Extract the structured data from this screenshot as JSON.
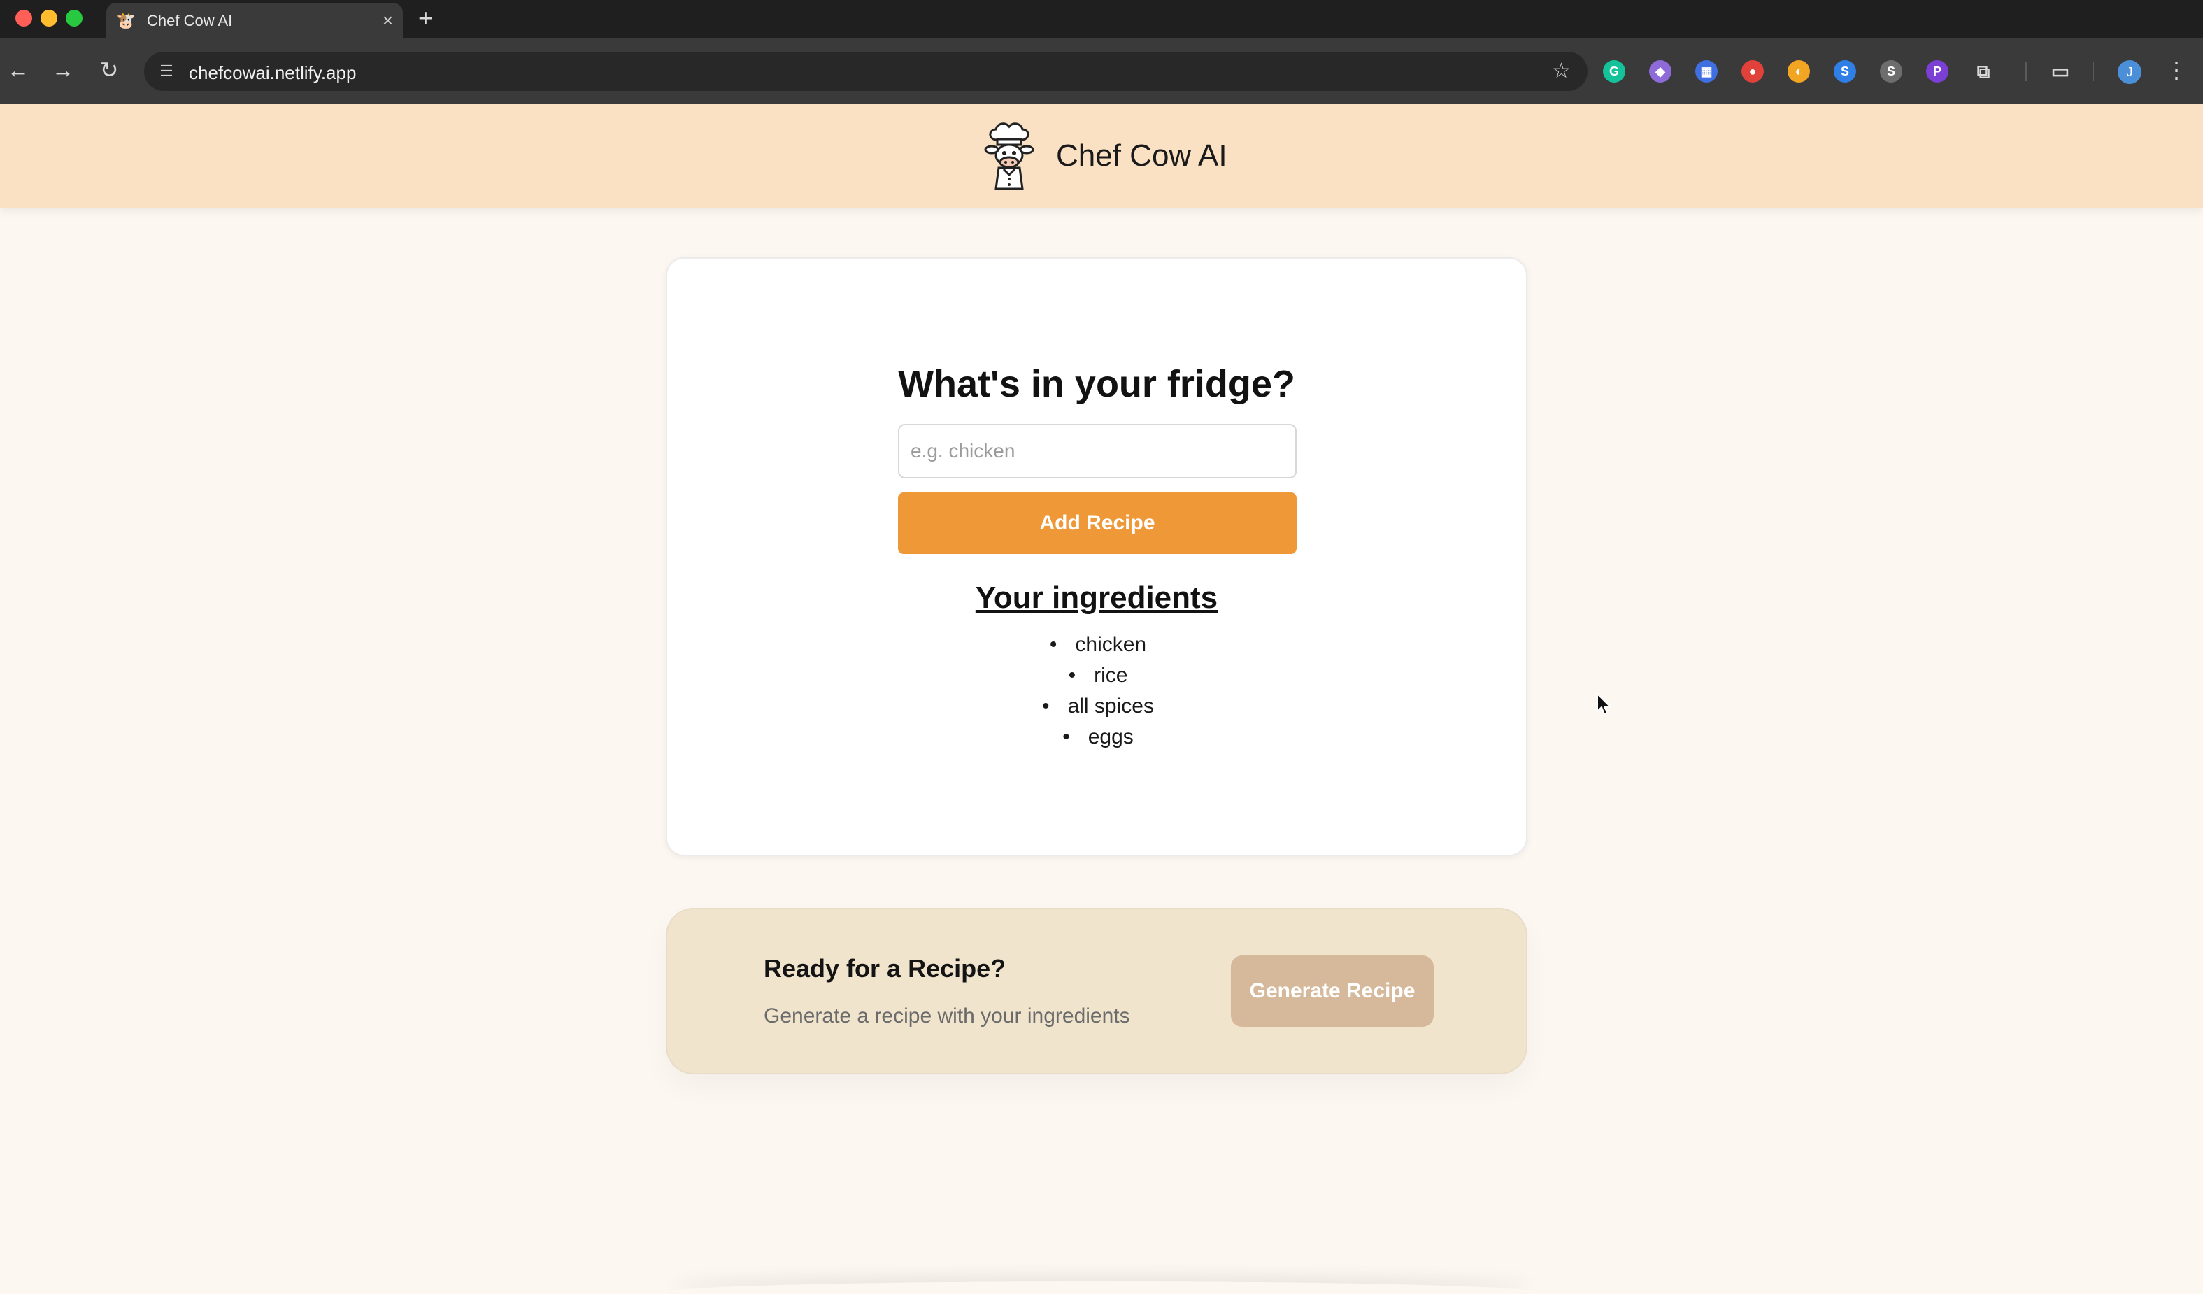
{
  "browser": {
    "tab_title": "Chef Cow AI",
    "tab_close": "×",
    "new_tab": "+",
    "url": "chefcowai.netlify.app",
    "back": "←",
    "forward": "→",
    "reload": "↻",
    "star": "☆",
    "menu": "⋮",
    "avatar_initial": "J",
    "extensions": [
      {
        "name": "grammarly-extension-icon",
        "glyph": "G",
        "color": "#15c39a"
      },
      {
        "name": "purple-extension-icon",
        "glyph": "◆",
        "color": "#8e6bd8"
      },
      {
        "name": "blue-tiles-extension-icon",
        "glyph": "▦",
        "color": "#3f6fe0"
      },
      {
        "name": "record-extension-icon",
        "glyph": "●",
        "color": "#e0413a"
      },
      {
        "name": "colorful-extension-icon",
        "glyph": "◐",
        "color": "#f1a522"
      },
      {
        "name": "swirl-extension-icon",
        "glyph": "S",
        "color": "#2f7fe6"
      },
      {
        "name": "s-circle-extension-icon",
        "glyph": "S",
        "color": "#6d6d6d"
      },
      {
        "name": "p-extension-icon",
        "glyph": "P",
        "color": "#7b3fd6"
      }
    ]
  },
  "app": {
    "brand": "Chef Cow AI"
  },
  "card": {
    "title": "What's in your fridge?",
    "input_placeholder": "e.g. chicken",
    "add_button": "Add Recipe",
    "ingredients_heading": "Your ingredients",
    "ingredients": [
      "chicken",
      "rice",
      "all spices",
      "eggs"
    ]
  },
  "recipe_panel": {
    "title": "Ready for a Recipe?",
    "subtitle": "Generate a recipe with your ingredients",
    "button": "Generate Recipe"
  },
  "colors": {
    "header_bg": "#fae1c4",
    "accent": "#ef9838",
    "panel_bg": "#f1e4cc",
    "generate_button": "#d6b89b"
  }
}
